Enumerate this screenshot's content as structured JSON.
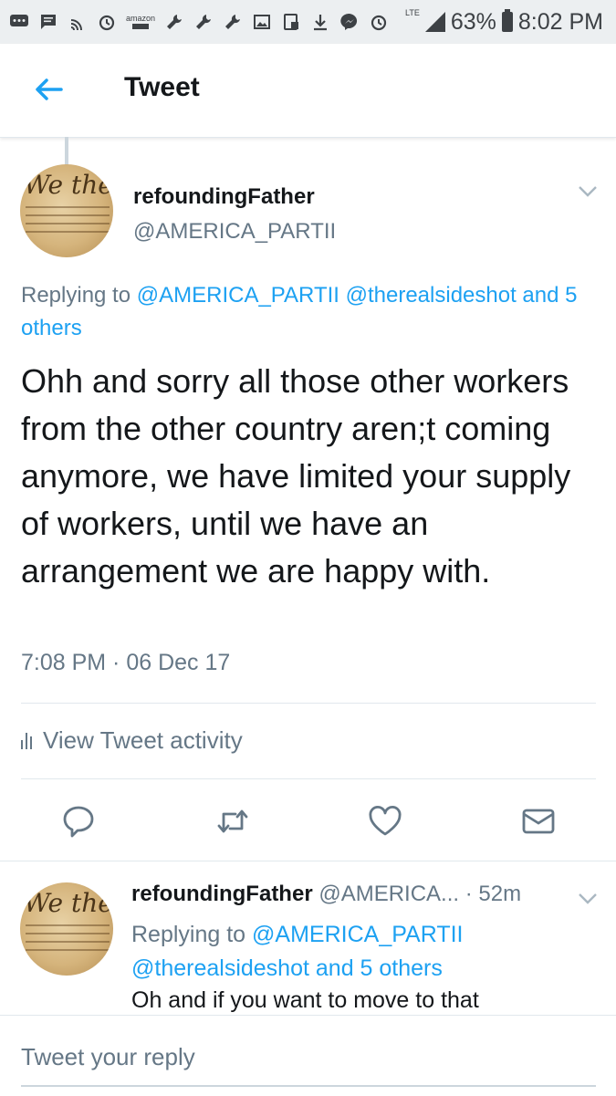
{
  "status_bar": {
    "battery": "63%",
    "time": "8:02 PM",
    "network": "LTE",
    "amazon_label": "amazon",
    "left_icons": [
      "messages-icon",
      "sms-icon",
      "cast-icon",
      "alarm-icon",
      "amazon-icon",
      "wrench-icon",
      "wrench-icon",
      "wrench-icon",
      "gallery-icon",
      "screenshot-icon",
      "download-icon",
      "messenger-icon",
      "alarm-icon"
    ]
  },
  "header": {
    "title": "Tweet"
  },
  "tweet": {
    "display_name": "refoundingFather",
    "handle": "@AMERICA_PARTII",
    "replying_prefix": "Replying to",
    "replying_users": [
      "@AMERICA_PARTII",
      "@therealsideshot"
    ],
    "replying_others": "and 5 others",
    "text": "Ohh and sorry all those other workers from the other country aren;t coming anymore, we have limited your supply of workers, until we have an arrangement we are happy with.",
    "timestamp": "7:08 PM · 06 Dec 17",
    "activity_label": "View Tweet activity",
    "avatar_script": "We the Pe"
  },
  "reply": {
    "display_name": "refoundingFather",
    "handle": "@AMERICA...",
    "time": "· 52m",
    "replying_prefix": "Replying to",
    "replying_user_1": "@AMERICA_PARTII",
    "replying_user_2": "@therealsideshot",
    "replying_others": "and 5 others",
    "text": "Oh and if you want to move to that",
    "avatar_script": "We the Pe"
  },
  "composer": {
    "placeholder": "Tweet your reply"
  },
  "colors": {
    "link": "#1da1f2",
    "secondary": "#657786",
    "primary_text": "#14171a",
    "status_bar_bg": "#eceff1"
  }
}
